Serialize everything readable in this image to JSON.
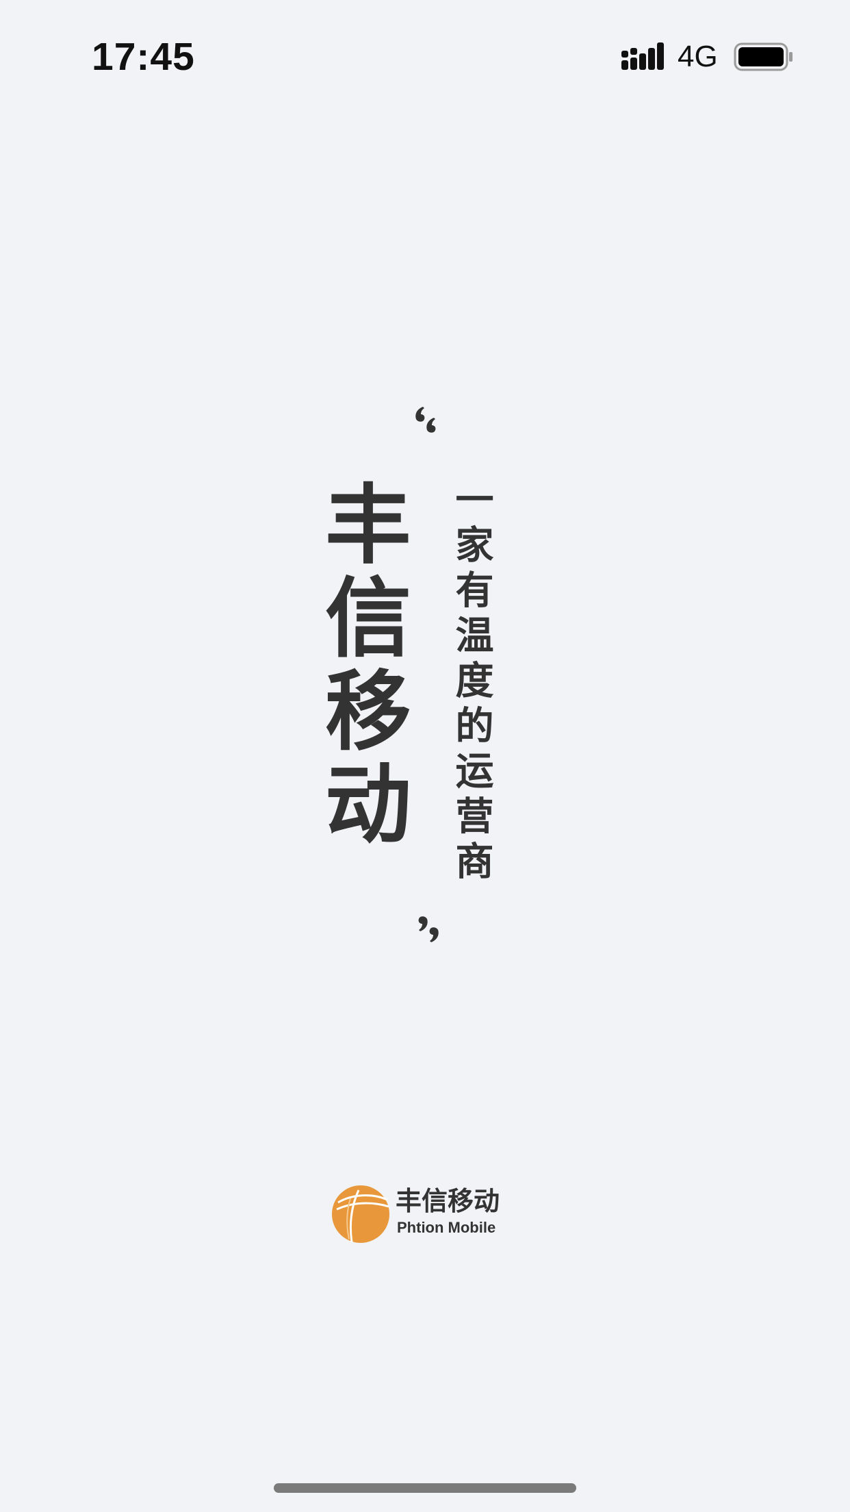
{
  "status_bar": {
    "time": "17:45",
    "network": "4G",
    "signal_icon": "cellular-signal-icon",
    "battery_icon": "battery-full-icon"
  },
  "splash": {
    "brand_name": "丰信移动",
    "tagline": "一家有温度的运营商",
    "open_quote_icon": "open-quote-icon",
    "close_quote_icon": "close-quote-icon"
  },
  "logo": {
    "name_cn": "丰信移动",
    "name_en": "Phtion Mobile",
    "mark_icon": "phtion-logo-icon"
  },
  "colors": {
    "background": "#f2f3f6",
    "text": "#333333",
    "logo_orange": "#e8983a",
    "home_indicator": "#7a7a7a"
  }
}
